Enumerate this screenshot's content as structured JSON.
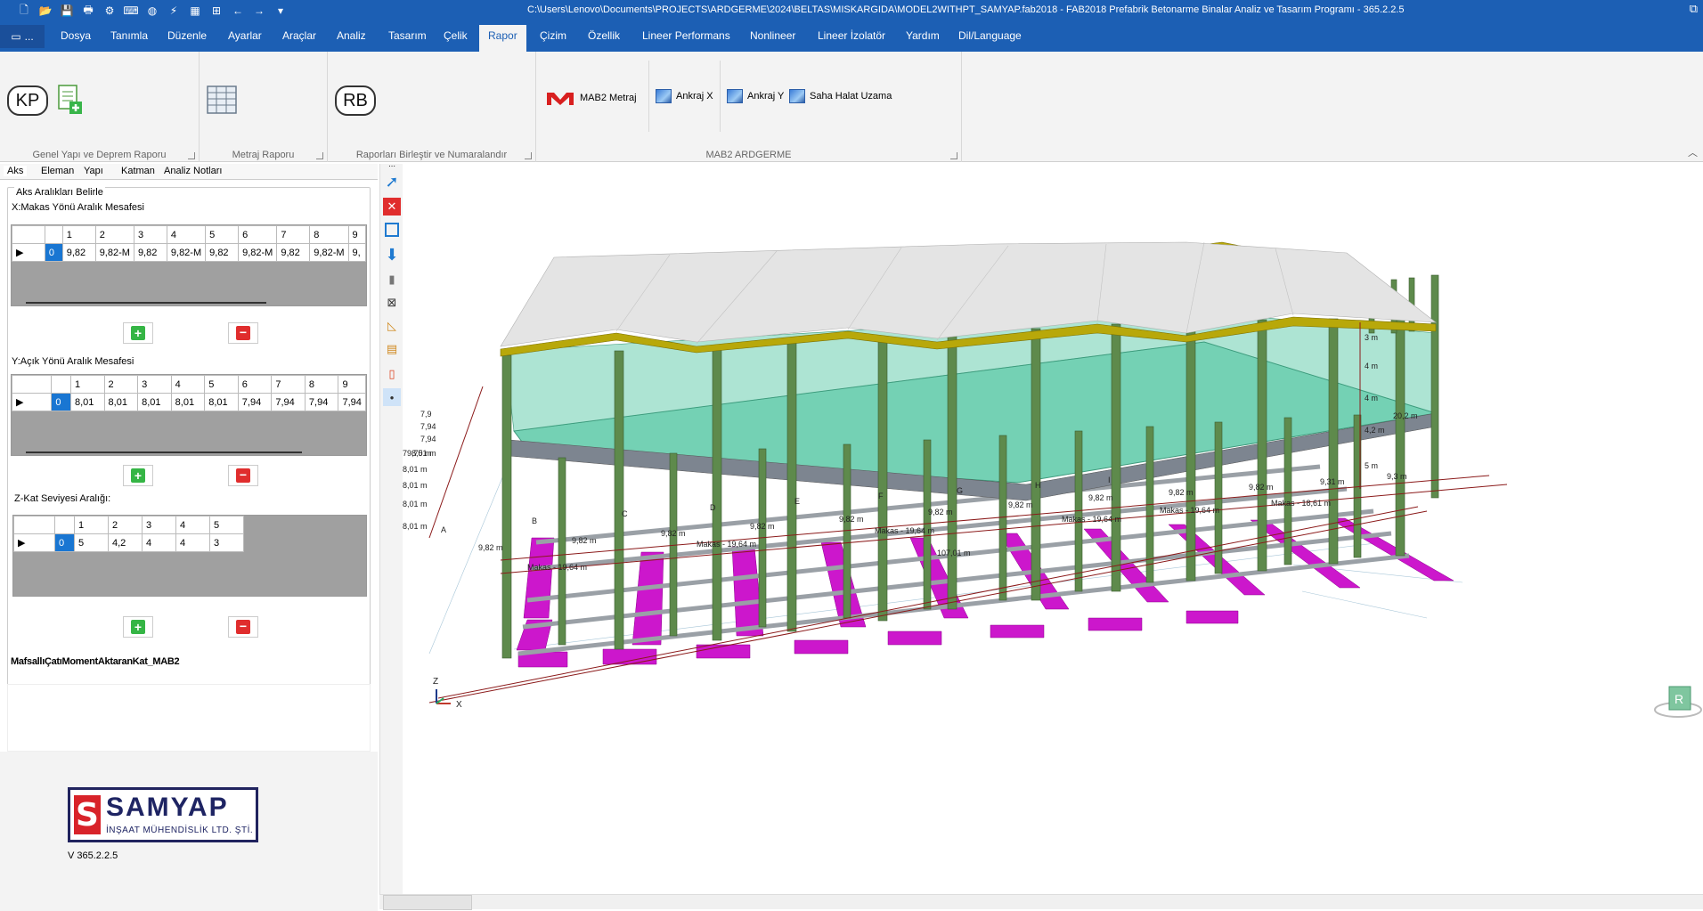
{
  "window": {
    "title": "C:\\Users\\Lenovo\\Documents\\PROJECTS\\ARDGERME\\2024\\BELTAS\\MISKARGIDA\\MODEL2WITHPT_SAMYAP.fab2018 - FAB2018 Prefabrik Betonarme Binalar Analiz ve Tasarım Programı - 365.2.2.5"
  },
  "app_button_label": "...",
  "menu": [
    "Dosya",
    "Tanımla",
    "Düzenle",
    "Ayarlar",
    "Araçlar",
    "Analiz",
    "Tasarım",
    "Çelik",
    "Rapor",
    "Çizim",
    "Özellik",
    "Lineer Performans",
    "Nonlineer",
    "Lineer İzolatör",
    "Yardım",
    "Dil/Language"
  ],
  "active_menu": "Rapor",
  "ribbon": {
    "groups": [
      {
        "label": "Genel Yapı ve Deprem Raporu"
      },
      {
        "label": "Metraj Raporu"
      },
      {
        "label": "Raporları Birleştir ve Numaralandır"
      },
      {
        "label": "MAB2 ARDGERME"
      }
    ],
    "kp_label": "KP",
    "rb_label": "RB",
    "mab2_metraj": "MAB2 Metraj",
    "ankraj_x": "Ankraj X",
    "ankraj_y": "Ankraj Y",
    "saha_halat": "Saha Halat Uzama"
  },
  "left_tabs": [
    "Aks",
    "Eleman",
    "Yapı",
    "Katman",
    "Analiz Notları"
  ],
  "aks": {
    "group_title": "Aks Aralıkları Belirle",
    "x_title": "X:Makas Yönü Aralık Mesafesi",
    "x_headers": [
      "1",
      "2",
      "3",
      "4",
      "5",
      "6",
      "7",
      "8",
      "9"
    ],
    "x_values": [
      "0",
      "9,82",
      "9,82-M",
      "9,82",
      "9,82-M",
      "9,82",
      "9,82-M",
      "9,82",
      "9,82-M",
      "9,"
    ],
    "y_title": "Y:Açık Yönü Aralık Mesafesi",
    "y_headers": [
      "1",
      "2",
      "3",
      "4",
      "5",
      "6",
      "7",
      "8",
      "9"
    ],
    "y_values": [
      "0",
      "8,01",
      "8,01",
      "8,01",
      "8,01",
      "8,01",
      "7,94",
      "7,94",
      "7,94",
      "7,94"
    ],
    "z_title": "Z-Kat Seviyesi Aralığı:",
    "z_headers": [
      "1",
      "2",
      "3",
      "4",
      "5"
    ],
    "z_values": [
      "0",
      "5",
      "4,2",
      "4",
      "4",
      "3"
    ]
  },
  "model_name": "MafsallıÇatıMomentAktaranKat_MAB2",
  "logo": {
    "name": "SAMYAP",
    "sub": "İNŞAAT MÜHENDİSLİK LTD. ŞTİ.",
    "mark": "S"
  },
  "version": "V 365.2.2.5",
  "viewport": {
    "dim_total": "107,01 m",
    "dim_makas": [
      "Makas - 19,64 m",
      "Makas - 19,64 m",
      "Makas - 19,64 m",
      "Makas - 19,64 m",
      "Makas - 19,64 m",
      "Makas - 18,61 m"
    ],
    "dim_spans": [
      "9,82 m",
      "9,82 m",
      "9,82 m",
      "9,82 m",
      "9,82 m",
      "9,82 m",
      "9,82 m",
      "9,82 m",
      "9,82 m",
      "9,82 m",
      "9,31 m",
      "9,3 m"
    ],
    "dim_y_total": "79,75 m",
    "dim_y": [
      "8,01 m",
      "8,01 m",
      "8,01 m",
      "8,01 m",
      "8,01 m",
      "7,94",
      "7,94",
      "7,9"
    ],
    "dim_z": [
      "3 m",
      "4 m",
      "4 m",
      "4,2 m",
      "5 m"
    ],
    "dim_z_total": "20,2 m",
    "axis_letters": [
      "A",
      "B",
      "C",
      "D",
      "E",
      "F",
      "G",
      "H",
      "I"
    ],
    "axis_z": "Z",
    "axis_x": "X",
    "cube_label": "R"
  },
  "colors": {
    "brand": "#1c5fb4",
    "slab": "#5cc9a7",
    "column": "#5e8a4c",
    "footing": "#cc17cc",
    "truss": "#b8a80a",
    "roof": "#e4e4e4"
  }
}
